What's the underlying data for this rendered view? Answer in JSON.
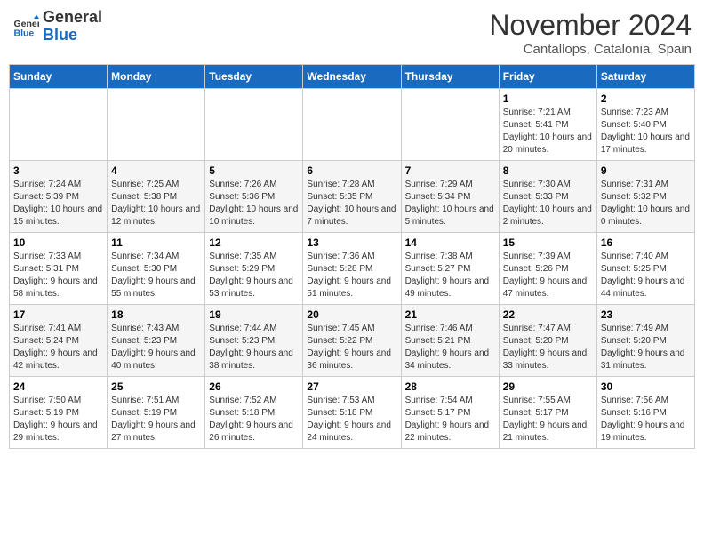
{
  "logo": {
    "line1": "General",
    "line2": "Blue"
  },
  "title": "November 2024",
  "location": "Cantallops, Catalonia, Spain",
  "days_of_week": [
    "Sunday",
    "Monday",
    "Tuesday",
    "Wednesday",
    "Thursday",
    "Friday",
    "Saturday"
  ],
  "weeks": [
    [
      {
        "day": "",
        "info": ""
      },
      {
        "day": "",
        "info": ""
      },
      {
        "day": "",
        "info": ""
      },
      {
        "day": "",
        "info": ""
      },
      {
        "day": "",
        "info": ""
      },
      {
        "day": "1",
        "info": "Sunrise: 7:21 AM\nSunset: 5:41 PM\nDaylight: 10 hours and 20 minutes."
      },
      {
        "day": "2",
        "info": "Sunrise: 7:23 AM\nSunset: 5:40 PM\nDaylight: 10 hours and 17 minutes."
      }
    ],
    [
      {
        "day": "3",
        "info": "Sunrise: 7:24 AM\nSunset: 5:39 PM\nDaylight: 10 hours and 15 minutes."
      },
      {
        "day": "4",
        "info": "Sunrise: 7:25 AM\nSunset: 5:38 PM\nDaylight: 10 hours and 12 minutes."
      },
      {
        "day": "5",
        "info": "Sunrise: 7:26 AM\nSunset: 5:36 PM\nDaylight: 10 hours and 10 minutes."
      },
      {
        "day": "6",
        "info": "Sunrise: 7:28 AM\nSunset: 5:35 PM\nDaylight: 10 hours and 7 minutes."
      },
      {
        "day": "7",
        "info": "Sunrise: 7:29 AM\nSunset: 5:34 PM\nDaylight: 10 hours and 5 minutes."
      },
      {
        "day": "8",
        "info": "Sunrise: 7:30 AM\nSunset: 5:33 PM\nDaylight: 10 hours and 2 minutes."
      },
      {
        "day": "9",
        "info": "Sunrise: 7:31 AM\nSunset: 5:32 PM\nDaylight: 10 hours and 0 minutes."
      }
    ],
    [
      {
        "day": "10",
        "info": "Sunrise: 7:33 AM\nSunset: 5:31 PM\nDaylight: 9 hours and 58 minutes."
      },
      {
        "day": "11",
        "info": "Sunrise: 7:34 AM\nSunset: 5:30 PM\nDaylight: 9 hours and 55 minutes."
      },
      {
        "day": "12",
        "info": "Sunrise: 7:35 AM\nSunset: 5:29 PM\nDaylight: 9 hours and 53 minutes."
      },
      {
        "day": "13",
        "info": "Sunrise: 7:36 AM\nSunset: 5:28 PM\nDaylight: 9 hours and 51 minutes."
      },
      {
        "day": "14",
        "info": "Sunrise: 7:38 AM\nSunset: 5:27 PM\nDaylight: 9 hours and 49 minutes."
      },
      {
        "day": "15",
        "info": "Sunrise: 7:39 AM\nSunset: 5:26 PM\nDaylight: 9 hours and 47 minutes."
      },
      {
        "day": "16",
        "info": "Sunrise: 7:40 AM\nSunset: 5:25 PM\nDaylight: 9 hours and 44 minutes."
      }
    ],
    [
      {
        "day": "17",
        "info": "Sunrise: 7:41 AM\nSunset: 5:24 PM\nDaylight: 9 hours and 42 minutes."
      },
      {
        "day": "18",
        "info": "Sunrise: 7:43 AM\nSunset: 5:23 PM\nDaylight: 9 hours and 40 minutes."
      },
      {
        "day": "19",
        "info": "Sunrise: 7:44 AM\nSunset: 5:23 PM\nDaylight: 9 hours and 38 minutes."
      },
      {
        "day": "20",
        "info": "Sunrise: 7:45 AM\nSunset: 5:22 PM\nDaylight: 9 hours and 36 minutes."
      },
      {
        "day": "21",
        "info": "Sunrise: 7:46 AM\nSunset: 5:21 PM\nDaylight: 9 hours and 34 minutes."
      },
      {
        "day": "22",
        "info": "Sunrise: 7:47 AM\nSunset: 5:20 PM\nDaylight: 9 hours and 33 minutes."
      },
      {
        "day": "23",
        "info": "Sunrise: 7:49 AM\nSunset: 5:20 PM\nDaylight: 9 hours and 31 minutes."
      }
    ],
    [
      {
        "day": "24",
        "info": "Sunrise: 7:50 AM\nSunset: 5:19 PM\nDaylight: 9 hours and 29 minutes."
      },
      {
        "day": "25",
        "info": "Sunrise: 7:51 AM\nSunset: 5:19 PM\nDaylight: 9 hours and 27 minutes."
      },
      {
        "day": "26",
        "info": "Sunrise: 7:52 AM\nSunset: 5:18 PM\nDaylight: 9 hours and 26 minutes."
      },
      {
        "day": "27",
        "info": "Sunrise: 7:53 AM\nSunset: 5:18 PM\nDaylight: 9 hours and 24 minutes."
      },
      {
        "day": "28",
        "info": "Sunrise: 7:54 AM\nSunset: 5:17 PM\nDaylight: 9 hours and 22 minutes."
      },
      {
        "day": "29",
        "info": "Sunrise: 7:55 AM\nSunset: 5:17 PM\nDaylight: 9 hours and 21 minutes."
      },
      {
        "day": "30",
        "info": "Sunrise: 7:56 AM\nSunset: 5:16 PM\nDaylight: 9 hours and 19 minutes."
      }
    ]
  ]
}
